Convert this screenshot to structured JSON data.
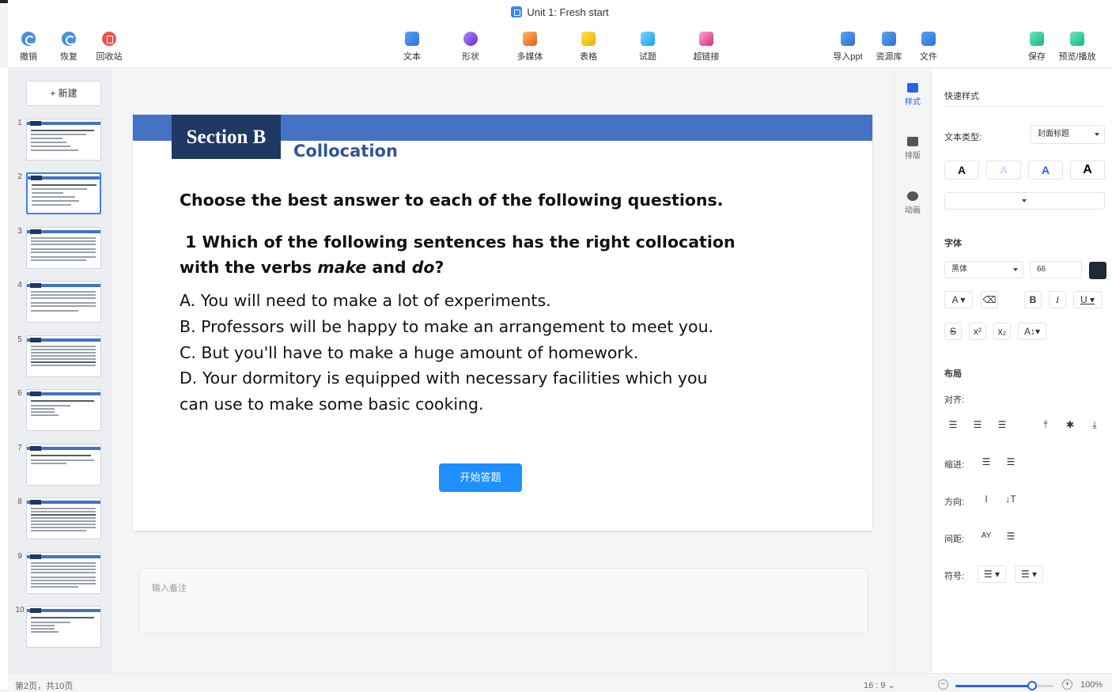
{
  "window": {
    "title": "Unit 1: Fresh start"
  },
  "toolbar": {
    "left": [
      {
        "id": "undo",
        "label": "撤销",
        "icon": "undo-icon"
      },
      {
        "id": "redo",
        "label": "恢复",
        "icon": "redo-icon"
      },
      {
        "id": "recycle",
        "label": "回收站",
        "icon": "trash-icon"
      }
    ],
    "center": [
      {
        "id": "text",
        "label": "文本",
        "icon": "text-icon"
      },
      {
        "id": "shape",
        "label": "形状",
        "icon": "shape-icon"
      },
      {
        "id": "media",
        "label": "多媒体",
        "icon": "media-icon"
      },
      {
        "id": "table",
        "label": "表格",
        "icon": "table-icon"
      },
      {
        "id": "quiz",
        "label": "试题",
        "icon": "quiz-icon"
      },
      {
        "id": "hyperlink",
        "label": "超链接",
        "icon": "link-icon"
      }
    ],
    "right": [
      {
        "id": "import",
        "label": "导入ppt",
        "icon": "import-icon"
      },
      {
        "id": "library",
        "label": "资源库",
        "icon": "library-icon"
      },
      {
        "id": "file",
        "label": "文件",
        "icon": "file-icon"
      }
    ],
    "far_right": [
      {
        "id": "save",
        "label": "保存",
        "icon": "save-icon"
      },
      {
        "id": "preview",
        "label": "预览/播放",
        "icon": "play-icon"
      }
    ]
  },
  "slides_panel": {
    "new_button": "+ 新建",
    "thumbnails": [
      "1",
      "2",
      "3",
      "4",
      "5",
      "6",
      "7",
      "8",
      "9",
      "10"
    ],
    "active_index": 1
  },
  "slide": {
    "section": "Section B",
    "subtitle": "Collocation",
    "instruction": "Choose the best answer to each of the following questions.",
    "question_line1": " 1 Which of the following sentences has the right collocation",
    "question_line2_a": "with the verbs ",
    "question_verb1": "make",
    "question_and": " and ",
    "question_verb2": "do",
    "question_end": "?",
    "options": [
      "A. You will need to make a lot of experiments.",
      "B. Professors will be happy to make an arrangement to meet you.",
      "C. But you'll have to make a huge amount of homework.",
      "D. Your dormitory is equipped with necessary facilities which you",
      "can use to make some basic cooking."
    ],
    "start_button": "开始答题"
  },
  "notes": {
    "placeholder": "输入备注"
  },
  "side_tabs": [
    {
      "label": "样式",
      "icon": "style-icon",
      "active": true
    },
    {
      "label": "排版",
      "icon": "layout-icon",
      "active": false
    },
    {
      "label": "动画",
      "icon": "animation-icon",
      "active": false
    }
  ],
  "properties": {
    "quick_style": "快速样式",
    "text_type_label": "文本类型:",
    "text_type_value": "封面标题",
    "font_section": "字体",
    "font_family": "黑体",
    "font_size": "66",
    "font_color": "#1f2937",
    "layout_section": "布局",
    "align_label": "对齐:",
    "indent_label": "缩进:",
    "direction_label": "方向:",
    "spacing_label": "间距:",
    "symbol_label": "符号:",
    "quick_style_buttons": [
      "A",
      "A",
      "A",
      "A"
    ]
  },
  "status": {
    "page_info": "第2页，共10页",
    "ratio": "16 : 9",
    "zoom": "100%",
    "zoom_fraction": 0.78
  },
  "colors": {
    "band": "#4472c4",
    "section_box": "#1f3864",
    "subtitle": "#2f5597",
    "accent": "#1e90ff"
  }
}
